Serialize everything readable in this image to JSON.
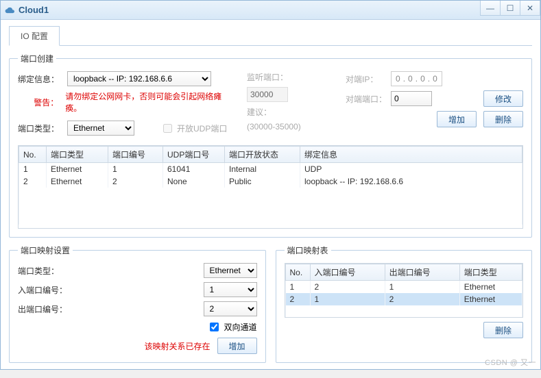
{
  "window": {
    "title": "Cloud1"
  },
  "tab": {
    "label": "IO 配置"
  },
  "portCreate": {
    "legend": "端口创建",
    "bindLabel": "绑定信息：",
    "bindValue": "loopback -- IP: 192.168.6.6",
    "warnLabel": "警告：",
    "warnText": "请勿绑定公网网卡，否则可能会引起网络瘫痪。",
    "typeLabel": "端口类型：",
    "typeValue": "Ethernet",
    "openUdpLabel": "开放UDP端口",
    "listen": {
      "label": "监听端口：",
      "value": "30000",
      "suggest": "建议：",
      "range": "(30000-35000)"
    },
    "peerIpLabel": "对端IP：",
    "peerIp": [
      "0",
      "0",
      "0",
      "0"
    ],
    "peerPortLabel": "对端端口：",
    "peerPortValue": "0",
    "modifyBtn": "修改",
    "addBtn": "增加",
    "deleteBtn": "删除",
    "table": {
      "headers": [
        "No.",
        "端口类型",
        "端口编号",
        "UDP端口号",
        "端口开放状态",
        "绑定信息"
      ],
      "rows": [
        {
          "no": "1",
          "type": "Ethernet",
          "portNo": "1",
          "udp": "61041",
          "open": "Internal",
          "bind": "UDP"
        },
        {
          "no": "2",
          "type": "Ethernet",
          "portNo": "2",
          "udp": "None",
          "open": "Public",
          "bind": "loopback -- IP: 192.168.6.6"
        }
      ]
    }
  },
  "mapSet": {
    "legend": "端口映射设置",
    "typeLabel": "端口类型：",
    "typeValue": "Ethernet",
    "inLabel": "入端口编号：",
    "inValue": "1",
    "outLabel": "出端口编号：",
    "outValue": "2",
    "bidirLabel": "双向通道",
    "existMsg": "该映射关系已存在",
    "addBtn": "增加"
  },
  "mapList": {
    "legend": "端口映射表",
    "headers": [
      "No.",
      "入端口编号",
      "出端口编号",
      "端口类型"
    ],
    "rows": [
      {
        "no": "1",
        "in": "2",
        "out": "1",
        "type": "Ethernet"
      },
      {
        "no": "2",
        "in": "1",
        "out": "2",
        "type": "Ethernet"
      }
    ],
    "deleteBtn": "删除"
  },
  "watermark": "CSDN @ 又一"
}
